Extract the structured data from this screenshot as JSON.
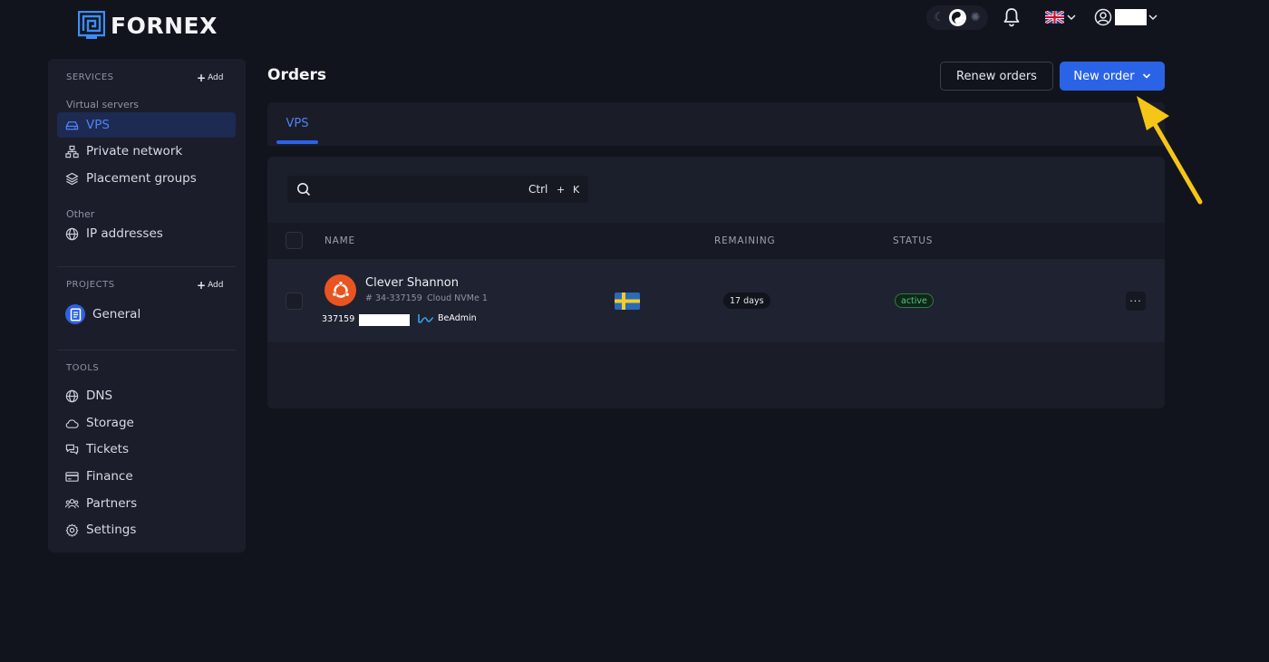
{
  "brand": {
    "name": "FORNEX"
  },
  "sidebar": {
    "services": {
      "title": "SERVICES",
      "add_label": "Add",
      "groups": [
        {
          "label": "Virtual servers",
          "items": [
            "VPS",
            "Private network",
            "Placement groups"
          ]
        },
        {
          "label": "Other",
          "items": [
            "IP addresses"
          ]
        }
      ]
    },
    "projects": {
      "title": "PROJECTS",
      "add_label": "Add",
      "items": [
        "General"
      ]
    },
    "tools": {
      "title": "TOOLS",
      "items": [
        "DNS",
        "Storage",
        "Tickets",
        "Finance",
        "Partners",
        "Settings"
      ]
    }
  },
  "main": {
    "title": "Orders",
    "renew_label": "Renew orders",
    "new_order_label": "New order",
    "tabs": [
      "VPS"
    ],
    "search": {
      "shortcut_key1": "Ctrl",
      "shortcut_plus": "+",
      "shortcut_key2": "K"
    },
    "table": {
      "columns": [
        "NAME",
        "REMAINING",
        "STATUS"
      ],
      "rows": [
        {
          "name": "Clever Shannon",
          "id": "34-337159",
          "plan": "Cloud NVMe 1",
          "tag_id": "337159",
          "tag_admin": "BeAdmin",
          "remaining": "17 days",
          "status": "active",
          "more": "···"
        }
      ]
    }
  },
  "colors": {
    "accent": "#2b63e6",
    "active_bg": "#1d2a52",
    "status_green": "#4fc97a",
    "annotation_arrow": "#f5c518"
  }
}
